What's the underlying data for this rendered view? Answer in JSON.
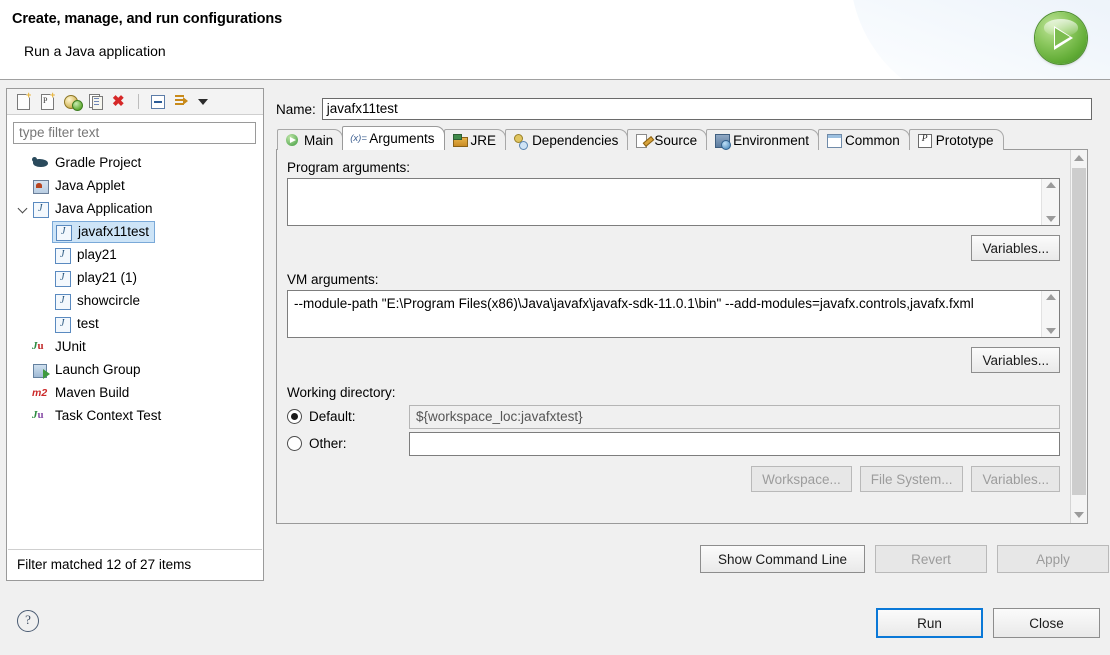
{
  "banner": {
    "title": "Create, manage, and run configurations",
    "subtitle": "Run a Java application",
    "icon": "run-green-play-icon"
  },
  "left_panel": {
    "toolbar": [
      {
        "name": "new-configuration-icon",
        "tooltip": "New launch configuration"
      },
      {
        "name": "new-prototype-icon",
        "tooltip": "New prototype"
      },
      {
        "name": "export-run-icon",
        "tooltip": "Export"
      },
      {
        "name": "duplicate-icon",
        "tooltip": "Duplicate"
      },
      {
        "name": "delete-icon",
        "tooltip": "Delete"
      },
      {
        "name": "collapse-all-icon",
        "tooltip": "Collapse All"
      },
      {
        "name": "filter-icon",
        "tooltip": "Filter"
      },
      {
        "name": "view-menu-icon",
        "tooltip": "View Menu"
      }
    ],
    "filter_placeholder": "type filter text",
    "filter_value": "",
    "tree": [
      {
        "label": "Gradle Project",
        "icon": "gradle-icon",
        "level": 0,
        "expanded": null,
        "selected": false
      },
      {
        "label": "Java Applet",
        "icon": "java-applet-icon",
        "level": 0,
        "expanded": null,
        "selected": false
      },
      {
        "label": "Java Application",
        "icon": "java-application-icon",
        "level": 0,
        "expanded": true,
        "selected": false
      },
      {
        "label": "javafx11test",
        "icon": "java-application-icon",
        "level": 1,
        "expanded": null,
        "selected": true
      },
      {
        "label": "play21",
        "icon": "java-application-icon",
        "level": 1,
        "expanded": null,
        "selected": false
      },
      {
        "label": "play21 (1)",
        "icon": "java-application-icon",
        "level": 1,
        "expanded": null,
        "selected": false
      },
      {
        "label": "showcircle",
        "icon": "java-application-icon",
        "level": 1,
        "expanded": null,
        "selected": false
      },
      {
        "label": "test",
        "icon": "java-application-icon",
        "level": 1,
        "expanded": null,
        "selected": false
      },
      {
        "label": "JUnit",
        "icon": "junit-icon",
        "level": 0,
        "expanded": null,
        "selected": false
      },
      {
        "label": "Launch Group",
        "icon": "launch-group-icon",
        "level": 0,
        "expanded": null,
        "selected": false
      },
      {
        "label": "Maven Build",
        "icon": "maven-icon",
        "level": 0,
        "expanded": null,
        "selected": false
      },
      {
        "label": "Task Context Test",
        "icon": "task-context-test-icon",
        "level": 0,
        "expanded": null,
        "selected": false
      }
    ],
    "status": "Filter matched 12 of 27 items"
  },
  "config": {
    "name_label": "Name:",
    "name_value": "javafx11test"
  },
  "tabs": [
    {
      "label": "Main",
      "icon": "main-tab-icon",
      "active": false
    },
    {
      "label": "Arguments",
      "icon": "arguments-tab-icon",
      "active": true
    },
    {
      "label": "JRE",
      "icon": "jre-tab-icon",
      "active": false
    },
    {
      "label": "Dependencies",
      "icon": "dependencies-tab-icon",
      "active": false
    },
    {
      "label": "Source",
      "icon": "source-tab-icon",
      "active": false
    },
    {
      "label": "Environment",
      "icon": "environment-tab-icon",
      "active": false
    },
    {
      "label": "Common",
      "icon": "common-tab-icon",
      "active": false
    },
    {
      "label": "Prototype",
      "icon": "prototype-tab-icon",
      "active": false
    }
  ],
  "arguments_tab": {
    "program_arguments": {
      "label": "Program arguments:",
      "value": "",
      "variables_button": "Variables..."
    },
    "vm_arguments": {
      "label": "VM arguments:",
      "value": "--module-path \"E:\\Program Files(x86)\\Java\\javafx\\javafx-sdk-11.0.1\\bin\" --add-modules=javafx.controls,javafx.fxml",
      "variables_button": "Variables..."
    },
    "working_directory": {
      "label": "Working directory:",
      "default_label": "Default:",
      "default_value": "${workspace_loc:javafxtest}",
      "default_selected": true,
      "other_label": "Other:",
      "other_value": "",
      "other_selected": false,
      "buttons": [
        {
          "label": "Workspace...",
          "enabled": false
        },
        {
          "label": "File System...",
          "enabled": false
        },
        {
          "label": "Variables...",
          "enabled": false
        }
      ]
    }
  },
  "action_buttons": [
    {
      "label": "Show Command Line",
      "enabled": true
    },
    {
      "label": "Revert",
      "enabled": false
    },
    {
      "label": "Apply",
      "enabled": false
    }
  ],
  "footer": {
    "help_icon": "help-icon",
    "buttons": [
      {
        "label": "Run",
        "enabled": true,
        "default": true
      },
      {
        "label": "Close",
        "enabled": true,
        "default": false
      }
    ]
  }
}
